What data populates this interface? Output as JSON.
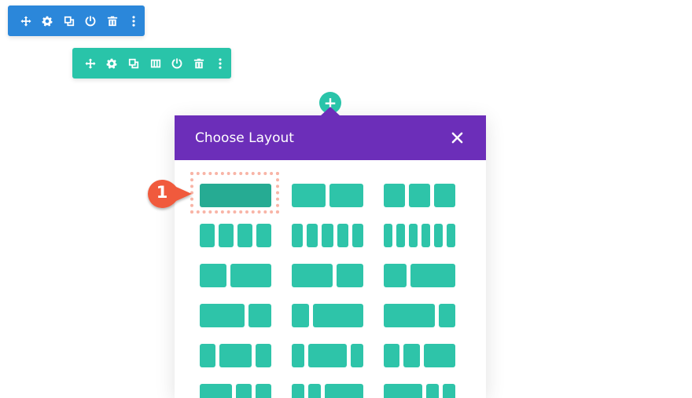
{
  "colors": {
    "section_toolbar": "#2b87da",
    "row_toolbar": "#29c4a9",
    "modal_header": "#6c2eb9",
    "layout_column": "#2ec4a9",
    "layout_column_selected": "#26ab93",
    "callout": "#f05a3c",
    "highlight": "#f8b4a6"
  },
  "section_toolbar": {
    "icons": [
      "move-icon",
      "gear-icon",
      "duplicate-icon",
      "power-icon",
      "trash-icon",
      "more-icon"
    ]
  },
  "row_toolbar": {
    "icons": [
      "move-icon",
      "gear-icon",
      "duplicate-icon",
      "columns-icon",
      "power-icon",
      "trash-icon",
      "more-icon"
    ]
  },
  "add_button": {
    "icon": "plus-icon",
    "label": "+"
  },
  "modal": {
    "title": "Choose Layout",
    "close_icon": "close-icon"
  },
  "layouts": [
    {
      "id": "1",
      "fractions": [
        1
      ],
      "selected": true
    },
    {
      "id": "1_2_1_2",
      "fractions": [
        0.5,
        0.5
      ]
    },
    {
      "id": "1_3_1_3_1_3",
      "fractions": [
        0.333,
        0.333,
        0.333
      ]
    },
    {
      "id": "1_4x4",
      "fractions": [
        0.25,
        0.25,
        0.25,
        0.25
      ]
    },
    {
      "id": "1_5x5",
      "fractions": [
        0.2,
        0.2,
        0.2,
        0.2,
        0.2
      ]
    },
    {
      "id": "1_6x6",
      "fractions": [
        0.167,
        0.167,
        0.167,
        0.167,
        0.167,
        0.167
      ]
    },
    {
      "id": "2_5_3_5",
      "fractions": [
        0.4,
        0.6
      ]
    },
    {
      "id": "3_5_2_5",
      "fractions": [
        0.6,
        0.4
      ]
    },
    {
      "id": "1_3_2_3",
      "fractions": [
        0.333,
        0.667
      ]
    },
    {
      "id": "2_3_1_3",
      "fractions": [
        0.667,
        0.333
      ]
    },
    {
      "id": "1_4_3_4",
      "fractions": [
        0.25,
        0.75
      ]
    },
    {
      "id": "3_4_1_4",
      "fractions": [
        0.75,
        0.25
      ]
    },
    {
      "id": "1_4_1_2_1_4",
      "fractions": [
        0.25,
        0.5,
        0.25
      ]
    },
    {
      "id": "1_5_3_5_1_5",
      "fractions": [
        0.2,
        0.6,
        0.2
      ]
    },
    {
      "id": "1_4_1_4_1_2",
      "fractions": [
        0.25,
        0.25,
        0.5
      ]
    },
    {
      "id": "1_2_1_4_1_4",
      "fractions": [
        0.5,
        0.25,
        0.25
      ]
    },
    {
      "id": "1_5_1_5_3_5",
      "fractions": [
        0.2,
        0.2,
        0.6
      ]
    },
    {
      "id": "3_5_1_5_1_5",
      "fractions": [
        0.6,
        0.2,
        0.2
      ]
    }
  ],
  "callout": {
    "number": "1"
  }
}
